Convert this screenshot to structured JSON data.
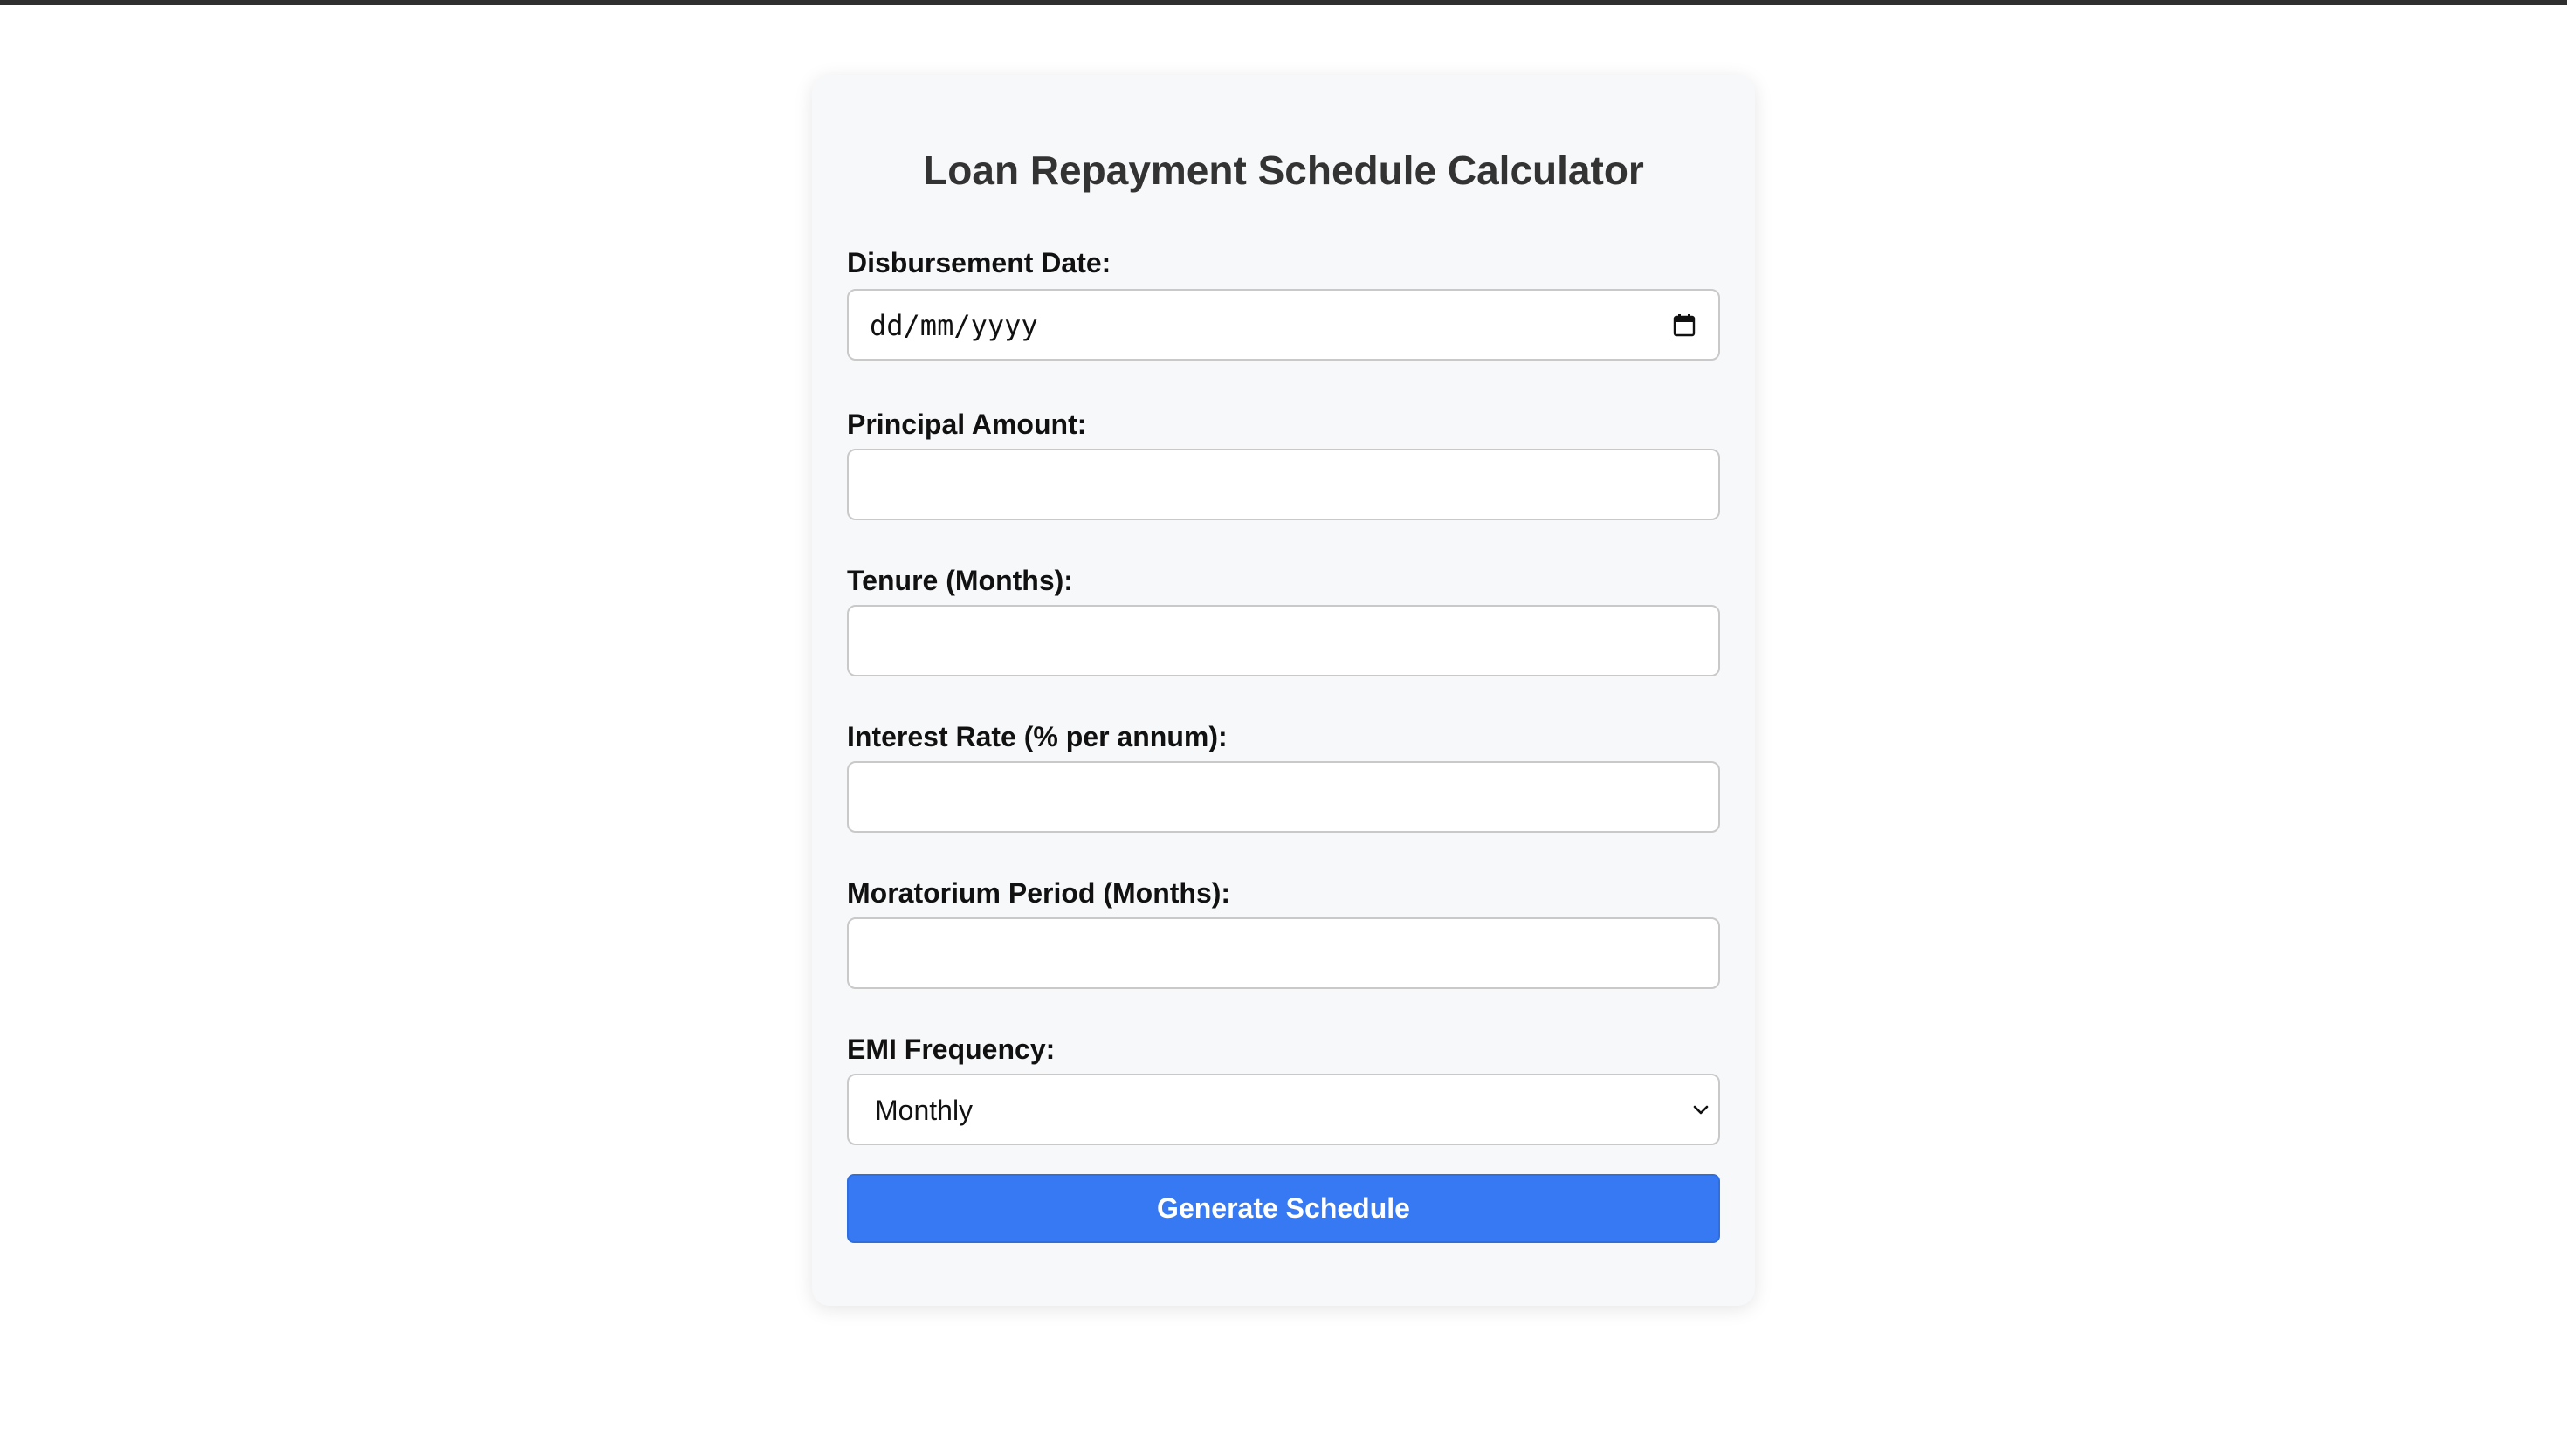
{
  "form": {
    "title": "Loan Repayment Schedule Calculator",
    "disbursement_date": {
      "label": "Disbursement Date:",
      "placeholder": "dd/mm/yyyy",
      "value": ""
    },
    "principal_amount": {
      "label": "Principal Amount:",
      "value": ""
    },
    "tenure_months": {
      "label": "Tenure (Months):",
      "value": ""
    },
    "interest_rate": {
      "label": "Interest Rate (% per annum):",
      "value": ""
    },
    "moratorium_period": {
      "label": "Moratorium Period (Months):",
      "value": ""
    },
    "emi_frequency": {
      "label": "EMI Frequency:",
      "selected": "Monthly"
    },
    "submit_label": "Generate Schedule"
  },
  "colors": {
    "page_background": "#ffffff",
    "top_bar": "#2f2f2f",
    "card_background": "#f7f8fa",
    "primary_button": "#3679f2",
    "title_text": "#333333"
  },
  "icons": {
    "date_picker": "calendar-icon",
    "select_dropdown": "chevron-down-icon"
  }
}
